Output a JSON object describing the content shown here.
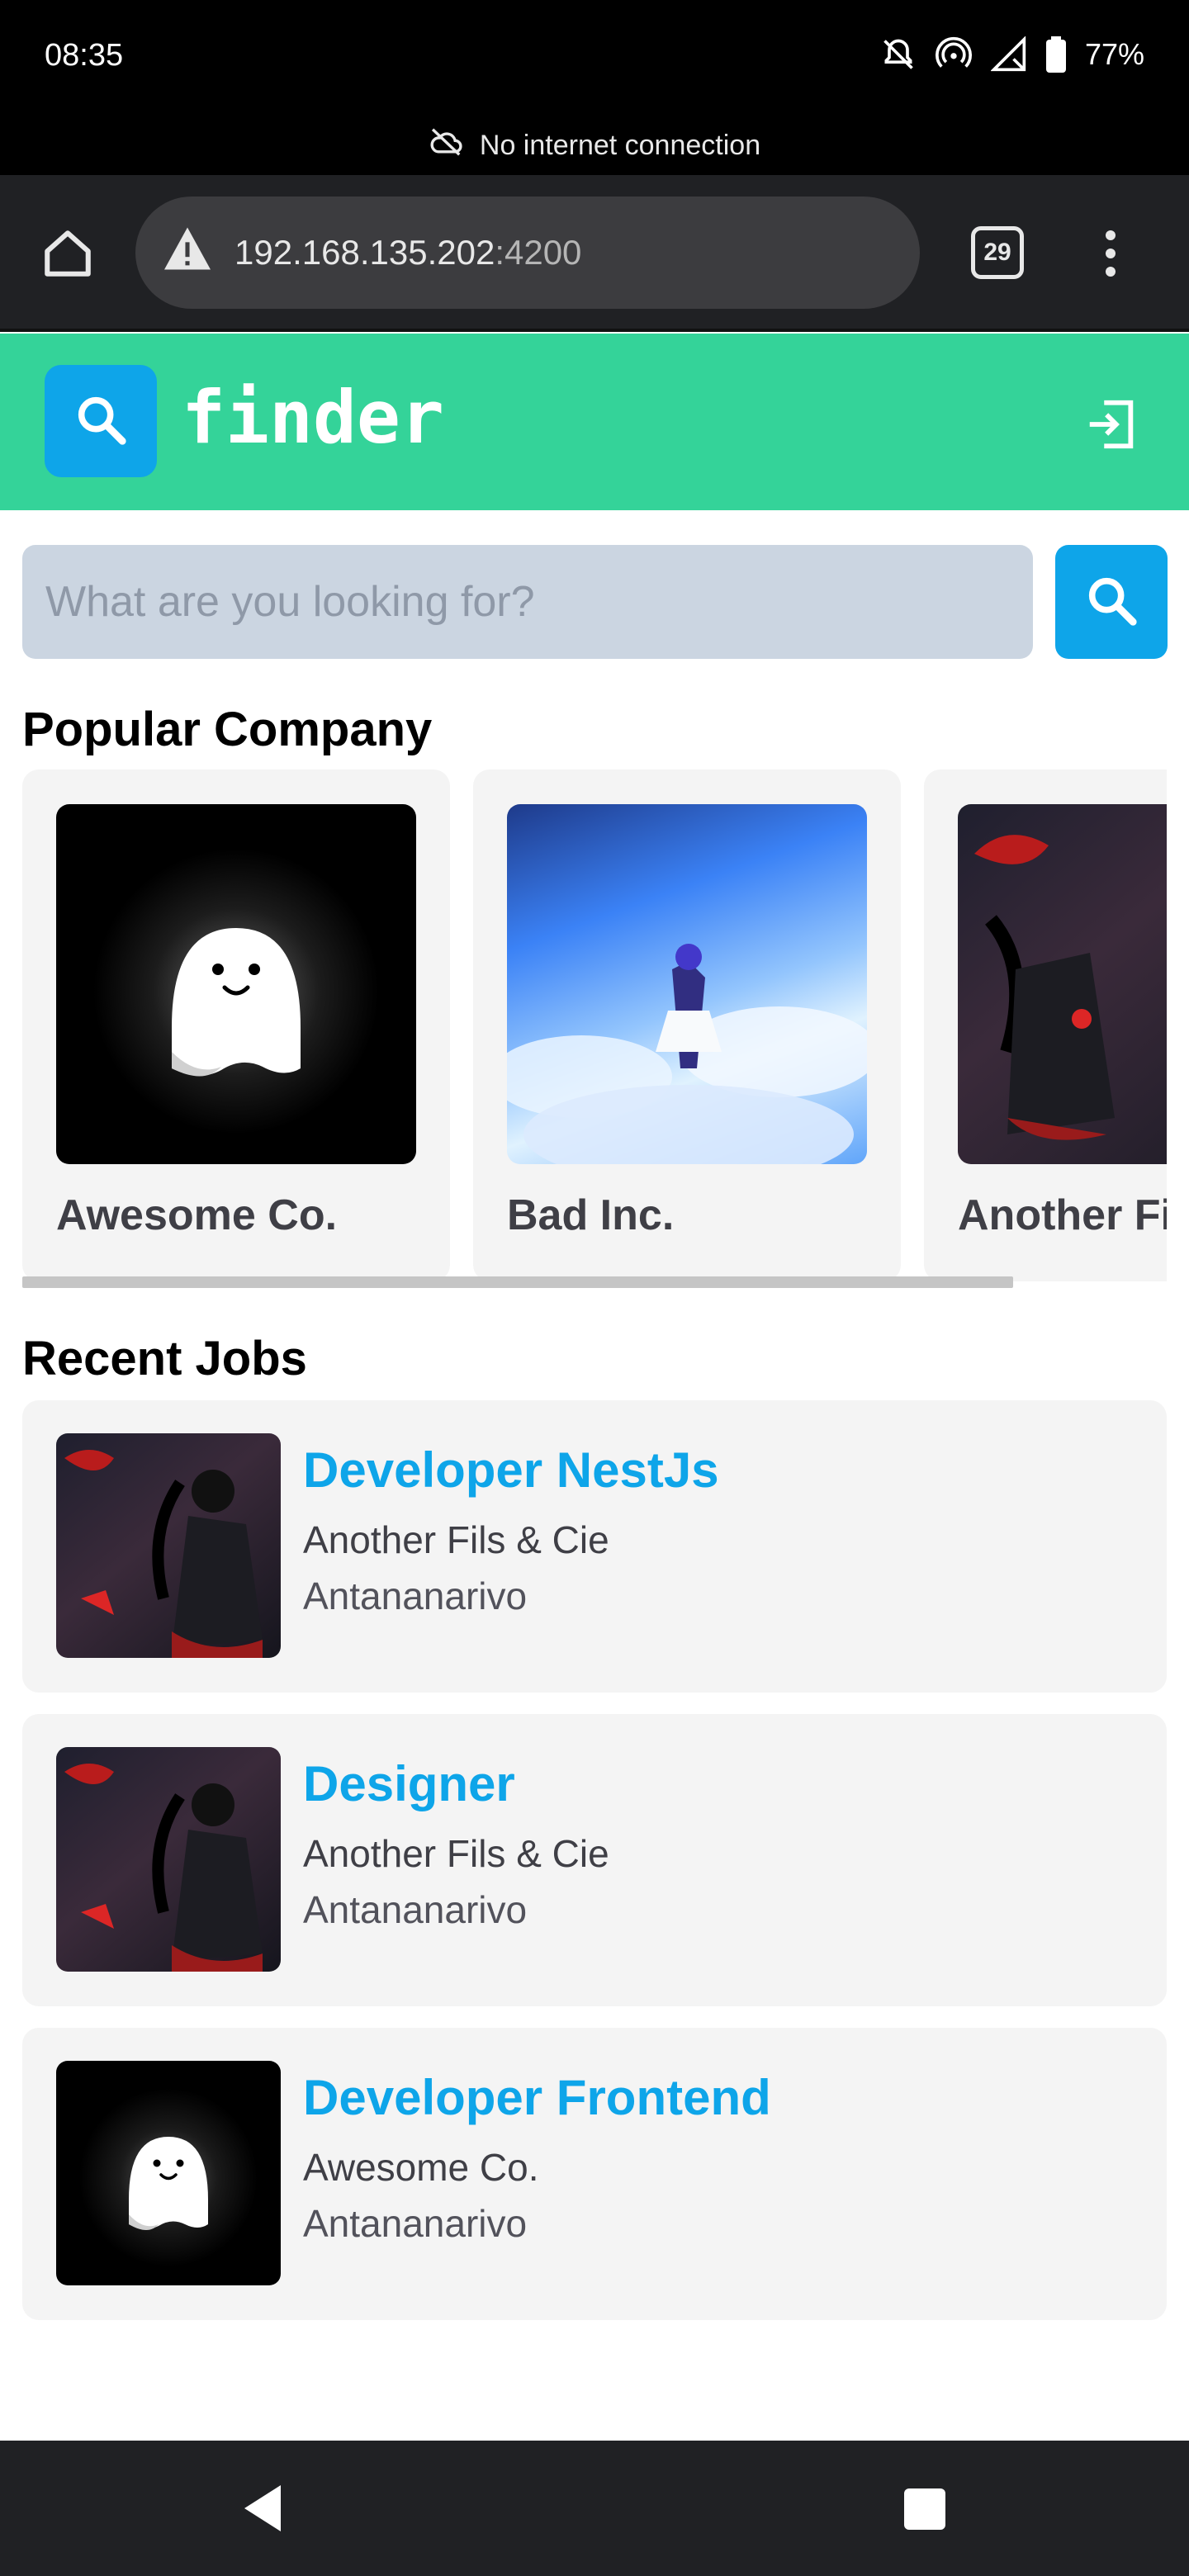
{
  "status_bar": {
    "time": "08:35",
    "battery": "77%",
    "icons": [
      "bell-off-icon",
      "hotspot-icon",
      "signal-icon",
      "battery-icon"
    ]
  },
  "connection_banner": {
    "text": "No internet connection",
    "icon": "cloud-off-icon"
  },
  "browser": {
    "url_host": "192.168.135.202",
    "url_port": ":4200",
    "tab_count": "29",
    "icons": [
      "home-icon",
      "warning-icon",
      "tabs-icon",
      "more-vert-icon"
    ]
  },
  "app_header": {
    "brand": "finder",
    "accent_color": "#34d399",
    "logo_color": "#0ea5e9",
    "icons": [
      "search-icon",
      "logout-icon"
    ]
  },
  "search": {
    "placeholder": "What are you looking for?",
    "value": ""
  },
  "popular": {
    "title": "Popular Company",
    "companies": [
      {
        "name": "Awesome Co.",
        "image": "ghost-logo"
      },
      {
        "name": "Bad Inc.",
        "image": "sky-illustration"
      },
      {
        "name": "Another Fils & Cie",
        "image": "dark-red-illustration"
      }
    ]
  },
  "recent": {
    "title": "Recent Jobs",
    "jobs": [
      {
        "title": "Developer NestJs",
        "company": "Another Fils & Cie",
        "location": "Antananarivo",
        "image": "dark-red-illustration"
      },
      {
        "title": "Designer",
        "company": "Another Fils & Cie",
        "location": "Antananarivo",
        "image": "dark-red-illustration"
      },
      {
        "title": "Developer Frontend",
        "company": "Awesome Co.",
        "location": "Antananarivo",
        "image": "ghost-logo"
      }
    ]
  },
  "nav_bar": {
    "icons": [
      "back-icon",
      "recents-icon"
    ]
  }
}
